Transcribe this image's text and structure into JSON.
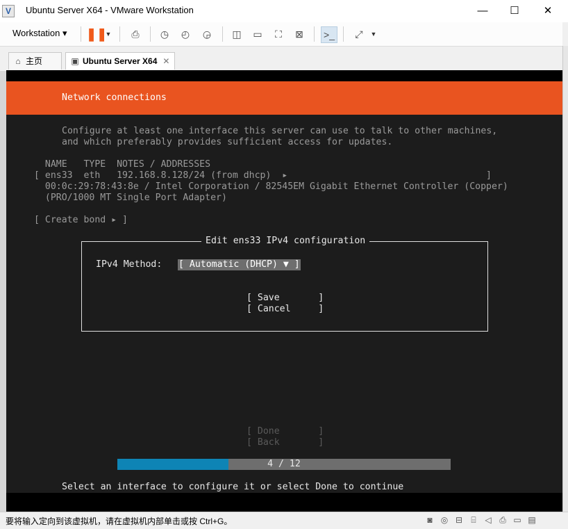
{
  "window": {
    "title": "Ubuntu Server X64 - VMware Workstation",
    "controls": {
      "minimize": "—",
      "maximize": "☐",
      "close": "✕"
    }
  },
  "toolbar": {
    "workstation_label": "Workstation ▾",
    "icons": [
      "pause-icon",
      "send-keys-icon",
      "snapshot-icon",
      "revert-snapshot-icon",
      "snapshot-manager-icon",
      "library-view-icon",
      "single-view-icon",
      "fullscreen-icon",
      "unity-icon",
      "console-view-icon",
      "stretch-icon"
    ]
  },
  "tabs": [
    {
      "label": "主页",
      "icon": "home-icon"
    },
    {
      "label": "Ubuntu Server X64",
      "icon": "vm-icon",
      "close": "✕"
    }
  ],
  "console": {
    "header": "Network connections",
    "intro_line1": "Configure at least one interface this server can use to talk to other machines,",
    "intro_line2": "and which preferably provides sufficient access for updates.",
    "table_header": "  NAME   TYPE  NOTES / ADDRESSES",
    "row1": "[ ens33  eth   192.168.8.128/24 (from dhcp)  ▸                                    ]",
    "row2": "  00:0c:29:78:43:8e / Intel Corporation / 82545EM Gigabit Ethernet Controller (Copper)",
    "row3": "  (PRO/1000 MT Single Port Adapter)",
    "create_bond": "[ Create bond ▸ ]",
    "dialog": {
      "title": "Edit ens33 IPv4 configuration",
      "method_label": "IPv4 Method:",
      "method_value": "[ Automatic (DHCP) ▼ ]",
      "save": "[ Save       ]",
      "cancel": "[ Cancel     ]"
    },
    "done": "[ Done       ]",
    "back": "[ Back       ]",
    "progress_text": "4 / 12",
    "progress_fraction": 0.333,
    "hint": "Select an interface to configure it or select Done to continue"
  },
  "status": {
    "text": "要将输入定向到该虚拟机，请在虚拟机内部单击或按 Ctrl+G。",
    "icons": [
      "hdd-icon",
      "cdrom-icon",
      "network-icon",
      "usb-icon",
      "sound-icon",
      "printer-icon",
      "display-icon",
      "message-icon"
    ]
  },
  "colors": {
    "ubuntu_orange": "#e95420",
    "progress_blue": "#0e84b5",
    "console_bg": "#1c1c1c"
  }
}
